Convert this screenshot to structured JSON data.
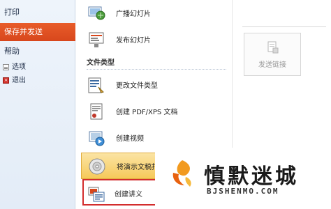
{
  "sidebar": {
    "print_label": "打印",
    "save_send_label": "保存并发送",
    "help_label": "帮助",
    "options_label": "选项",
    "exit_label": "退出"
  },
  "main": {
    "commands_top": [
      {
        "label": "广播幻灯片",
        "icon": "broadcast-icon"
      },
      {
        "label": "发布幻灯片",
        "icon": "publish-slides-icon"
      }
    ],
    "file_types_header": "文件类型",
    "file_types": [
      {
        "label": "更改文件类型",
        "icon": "change-file-type-icon"
      },
      {
        "label": "创建 PDF/XPS 文档",
        "icon": "pdf-xps-icon"
      },
      {
        "label": "创建视频",
        "icon": "video-icon"
      },
      {
        "label": "将演示文稿打",
        "icon": "cd-package-icon"
      },
      {
        "label": "创建讲义",
        "icon": "handouts-icon"
      }
    ]
  },
  "right_panel": {
    "send_link_label": "发送链接"
  },
  "watermark": {
    "title": "慎默迷城",
    "subtitle": "BJSHENMO.COM"
  },
  "colors": {
    "accent_orange": "#d8471c",
    "highlight_gold": "#f6c95a",
    "red_box": "#d32d2d"
  }
}
